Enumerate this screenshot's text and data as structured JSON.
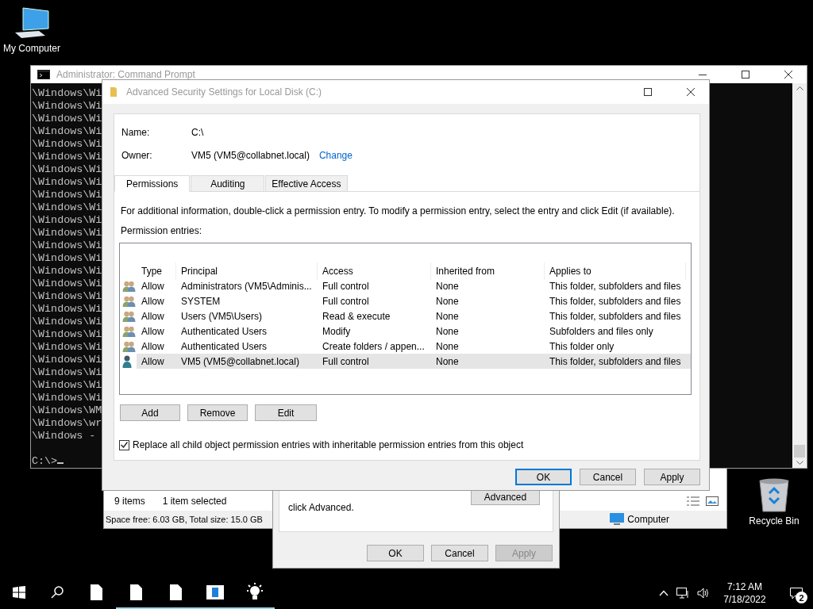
{
  "desktop_icons": [
    {
      "label": "My Computer",
      "kind": "computer"
    },
    {
      "label": "Recycle Bin",
      "kind": "recycle"
    }
  ],
  "explorer_window": {
    "item_count": "9 items",
    "selection": "1 item selected",
    "space": "Space free: 6.03 GB, Total size: 15.0 GB",
    "location": "Computer"
  },
  "properties_dialog": {
    "text": "click Advanced.",
    "advanced_button": "Advanced",
    "buttons": [
      {
        "label": "OK",
        "disabled": false
      },
      {
        "label": "Cancel",
        "disabled": false
      },
      {
        "label": "Apply",
        "disabled": true
      }
    ]
  },
  "console_window": {
    "title": "Administrator: Command Prompt",
    "lines": [
      "\\Windows\\Wi",
      "\\Windows\\Wi",
      "\\Windows\\Wi",
      "\\Windows\\Wi",
      "\\Windows\\Wi",
      "\\Windows\\Wi",
      "\\Windows\\Wi",
      "\\Windows\\Wi",
      "\\Windows\\Wi",
      "\\Windows\\Wi",
      "\\Windows\\Wi",
      "\\Windows\\Wi",
      "\\Windows\\Wi",
      "\\Windows\\Wi",
      "\\Windows\\Wi",
      "\\Windows\\Wi",
      "\\Windows\\Wi",
      "\\Windows\\Wi",
      "\\Windows\\Wi",
      "\\Windows\\Wi",
      "\\Windows\\Wi",
      "\\Windows\\Wi",
      "\\Windows\\Wi",
      "\\Windows\\Wi",
      "\\Windows\\Wi",
      "\\Windows\\WM",
      "\\Windows\\wr",
      "\\Windows -"
    ],
    "prompt": "C:\\>"
  },
  "security_dialog": {
    "title": "Advanced Security Settings for Local Disk (C:)",
    "name_label": "Name:",
    "name_value": "C:\\",
    "owner_label": "Owner:",
    "owner_value": "VM5 (VM5@collabnet.local)",
    "change_link": "Change",
    "tabs": [
      {
        "label": "Permissions",
        "selected": true
      },
      {
        "label": "Auditing",
        "selected": false
      },
      {
        "label": "Effective Access",
        "selected": false
      }
    ],
    "info": "For additional information, double-click a permission entry. To modify a permission entry, select the entry and click Edit (if available).",
    "entries_label": "Permission entries:",
    "columns": [
      "Type",
      "Principal",
      "Access",
      "Inherited from",
      "Applies to"
    ],
    "entries": [
      {
        "kind": "group",
        "type": "Allow",
        "principal": "Administrators (VM5\\Adminis...",
        "access": "Full control",
        "inherited_from": "None",
        "applies_to": "This folder, subfolders and files",
        "selected": false
      },
      {
        "kind": "group",
        "type": "Allow",
        "principal": "SYSTEM",
        "access": "Full control",
        "inherited_from": "None",
        "applies_to": "This folder, subfolders and files",
        "selected": false
      },
      {
        "kind": "group",
        "type": "Allow",
        "principal": "Users (VM5\\Users)",
        "access": "Read & execute",
        "inherited_from": "None",
        "applies_to": "This folder, subfolders and files",
        "selected": false
      },
      {
        "kind": "group",
        "type": "Allow",
        "principal": "Authenticated Users",
        "access": "Modify",
        "inherited_from": "None",
        "applies_to": "Subfolders and files only",
        "selected": false
      },
      {
        "kind": "group",
        "type": "Allow",
        "principal": "Authenticated Users",
        "access": "Create folders / appen...",
        "inherited_from": "None",
        "applies_to": "This folder only",
        "selected": false
      },
      {
        "kind": "user",
        "type": "Allow",
        "principal": "VM5 (VM5@collabnet.local)",
        "access": "Full control",
        "inherited_from": "None",
        "applies_to": "This folder, subfolders and files",
        "selected": true
      }
    ],
    "buttons": [
      "Add",
      "Remove",
      "Edit"
    ],
    "replace_checkbox": {
      "label": "Replace all child object permission entries with inheritable permission entries from this object",
      "checked": true
    },
    "footer_buttons": [
      {
        "label": "OK",
        "default": true
      },
      {
        "label": "Cancel",
        "default": false
      },
      {
        "label": "Apply",
        "default": false
      }
    ]
  },
  "taskbar": {
    "apps": [
      {
        "kind": "file",
        "running": false
      },
      {
        "kind": "file",
        "running": true
      },
      {
        "kind": "file",
        "running": true
      },
      {
        "kind": "window",
        "running": true
      },
      {
        "kind": "bulb",
        "running": true
      }
    ],
    "clock": {
      "time": "7:12 AM",
      "date": "7/18/2022"
    },
    "notifications": "2"
  }
}
